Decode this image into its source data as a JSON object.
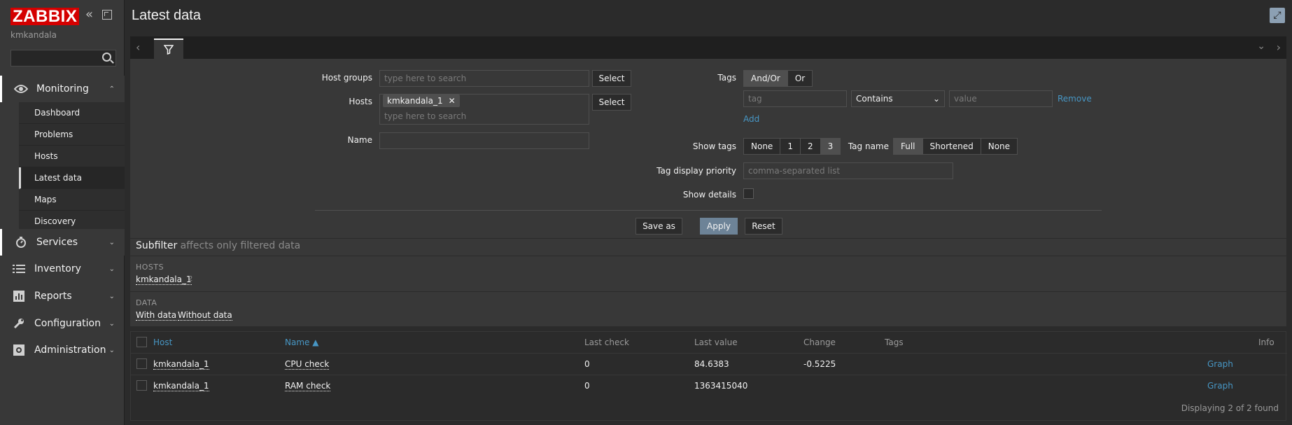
{
  "app": {
    "logo": "ZABBIX",
    "user": "kmkandala"
  },
  "sidebar": {
    "sections": [
      {
        "label": "Monitoring",
        "icon": "eye-icon",
        "expanded": true
      },
      {
        "label": "Services",
        "icon": "stopwatch-icon"
      },
      {
        "label": "Inventory",
        "icon": "list-icon"
      },
      {
        "label": "Reports",
        "icon": "bar-chart-icon"
      },
      {
        "label": "Configuration",
        "icon": "wrench-icon"
      },
      {
        "label": "Administration",
        "icon": "gear-icon"
      }
    ],
    "monitoring_items": [
      "Dashboard",
      "Problems",
      "Hosts",
      "Latest data",
      "Maps",
      "Discovery"
    ],
    "selected_item": "Latest data"
  },
  "header": {
    "title": "Latest data"
  },
  "filter": {
    "host_groups_label": "Host groups",
    "host_groups_placeholder": "type here to search",
    "select_label": "Select",
    "hosts_label": "Hosts",
    "hosts_chip": "kmkandala_1",
    "hosts_placeholder": "type here to search",
    "name_label": "Name",
    "name_value": "",
    "tags_label": "Tags",
    "tags_mode": [
      "And/Or",
      "Or"
    ],
    "tag_placeholder": "tag",
    "tag_operator": "Contains",
    "value_placeholder": "value",
    "remove_label": "Remove",
    "add_label": "Add",
    "show_tags_label": "Show tags",
    "show_tags_options": [
      "None",
      "1",
      "2",
      "3"
    ],
    "tag_name_label": "Tag name",
    "tag_name_options": [
      "Full",
      "Shortened",
      "None"
    ],
    "tag_priority_label": "Tag display priority",
    "tag_priority_placeholder": "comma-separated list",
    "show_details_label": "Show details",
    "save_as_label": "Save as",
    "apply_label": "Apply",
    "reset_label": "Reset"
  },
  "subfilter": {
    "title": "Subfilter",
    "note": "affects only filtered data",
    "hosts_heading": "HOSTS",
    "host_link": "kmkandala_1",
    "host_count": "2",
    "data_heading": "DATA",
    "with_data": "With data",
    "without_data": "Without data"
  },
  "table": {
    "columns": {
      "host": "Host",
      "name": "Name ▲",
      "last_check": "Last check",
      "last_value": "Last value",
      "change": "Change",
      "tags": "Tags",
      "info": "Info"
    },
    "rows": [
      {
        "host": "kmkandala_1",
        "name": "CPU check",
        "last_check": "0",
        "last_value": "84.6383",
        "change": "-0.5225",
        "graph": "Graph"
      },
      {
        "host": "kmkandala_1",
        "name": "RAM check",
        "last_check": "0",
        "last_value": "1363415040",
        "change": "",
        "graph": "Graph"
      }
    ],
    "footer": "Displaying 2 of 2 found"
  }
}
